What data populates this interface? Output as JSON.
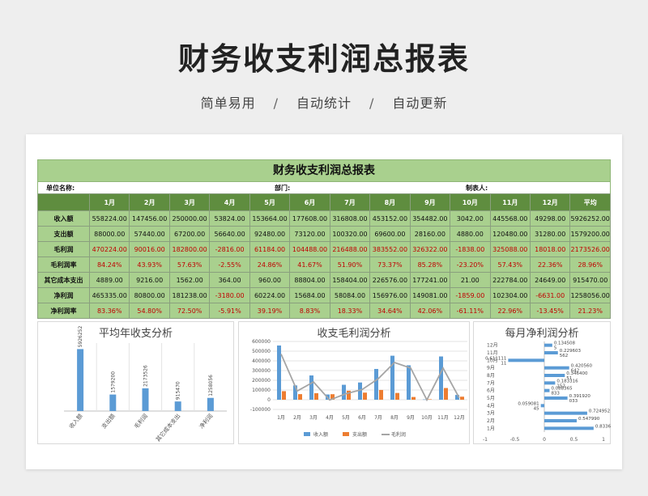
{
  "page": {
    "title": "财务收支利润总报表",
    "subtitle": [
      "简单易用",
      "/",
      "自动统计",
      "/",
      "自动更新"
    ]
  },
  "sheet": {
    "title": "财务收支利润总报表",
    "info": {
      "unit": "单位名称:",
      "dept": "部门:",
      "maker": "制表人:"
    },
    "months": [
      "1月",
      "2月",
      "3月",
      "4月",
      "5月",
      "6月",
      "7月",
      "8月",
      "9月",
      "10月",
      "11月",
      "12月",
      "平均"
    ],
    "rows": [
      {
        "label": "收入额",
        "type": "num",
        "values": [
          "558224.00",
          "147456.00",
          "250000.00",
          "53824.00",
          "153664.00",
          "177608.00",
          "316808.00",
          "453152.00",
          "354482.00",
          "3042.00",
          "445568.00",
          "49298.00",
          "5926252.00"
        ]
      },
      {
        "label": "支出额",
        "type": "num",
        "values": [
          "88000.00",
          "57440.00",
          "67200.00",
          "56640.00",
          "92480.00",
          "73120.00",
          "100320.00",
          "69600.00",
          "28160.00",
          "4880.00",
          "120480.00",
          "31280.00",
          "1579200.00"
        ]
      },
      {
        "label": "毛利润",
        "type": "red",
        "values": [
          "470224.00",
          "90016.00",
          "182800.00",
          "-2816.00",
          "61184.00",
          "104488.00",
          "216488.00",
          "383552.00",
          "326322.00",
          "-1838.00",
          "325088.00",
          "18018.00",
          "2173526.00"
        ]
      },
      {
        "label": "毛利润率",
        "type": "red",
        "values": [
          "84.24%",
          "43.93%",
          "57.63%",
          "-2.55%",
          "24.86%",
          "41.67%",
          "51.90%",
          "73.37%",
          "85.28%",
          "-23.20%",
          "57.43%",
          "22.36%",
          "28.96%"
        ]
      },
      {
        "label": "其它成本支出",
        "type": "num",
        "values": [
          "4889.00",
          "9216.00",
          "1562.00",
          "364.00",
          "960.00",
          "88804.00",
          "158404.00",
          "226576.00",
          "177241.00",
          "21.00",
          "222784.00",
          "24649.00",
          "915470.00"
        ]
      },
      {
        "label": "净利润",
        "type": "mixed",
        "values": [
          "465335.00",
          "80800.00",
          "181238.00",
          "-3180.00",
          "60224.00",
          "15684.00",
          "58084.00",
          "156976.00",
          "149081.00",
          "-1859.00",
          "102304.00",
          "-6631.00",
          "1258056.00"
        ]
      },
      {
        "label": "净利润率",
        "type": "red",
        "values": [
          "83.36%",
          "54.80%",
          "72.50%",
          "-5.91%",
          "39.19%",
          "8.83%",
          "18.33%",
          "34.64%",
          "42.06%",
          "-61.11%",
          "22.96%",
          "-13.45%",
          "21.23%"
        ]
      }
    ]
  },
  "chart_data": [
    {
      "type": "bar",
      "title": "平均年收支分析",
      "categories": [
        "收入额",
        "支出额",
        "毛利润",
        "其它成本支出",
        "净利润"
      ],
      "values": [
        5926252,
        1579200,
        2173526,
        915470,
        1258056
      ],
      "data_labels": [
        "5926252",
        "1579200",
        "2173526",
        "915470",
        "1258056"
      ],
      "colors": {
        "bar": "#5b9bd5"
      }
    },
    {
      "type": "bar",
      "title": "收支毛利润分析",
      "categories": [
        "1月",
        "2月",
        "3月",
        "4月",
        "5月",
        "6月",
        "7月",
        "8月",
        "9月",
        "10月",
        "11月",
        "12月"
      ],
      "ylim": [
        -100000,
        600000
      ],
      "yticks": [
        "600000",
        "500000",
        "400000",
        "300000",
        "200000",
        "100000",
        "0",
        "-100000"
      ],
      "series": [
        {
          "name": "收入额",
          "type": "bar",
          "color": "#5b9bd5",
          "values": [
            558224,
            147456,
            250000,
            53824,
            153664,
            177608,
            316808,
            453152,
            354482,
            3042,
            445568,
            49298
          ]
        },
        {
          "name": "支出额",
          "type": "bar",
          "color": "#ed7d31",
          "values": [
            88000,
            57440,
            67200,
            56640,
            92480,
            73120,
            100320,
            69600,
            28160,
            4880,
            120480,
            31280
          ]
        },
        {
          "name": "毛利润",
          "type": "line",
          "color": "#a5a5a5",
          "values": [
            470224,
            90016,
            182800,
            -2816,
            61184,
            104488,
            216488,
            383552,
            326322,
            -1838,
            325088,
            18018
          ]
        }
      ]
    },
    {
      "type": "bar",
      "orientation": "horizontal",
      "title": "每月净利润分析",
      "categories": [
        "1月",
        "2月",
        "3月",
        "4月",
        "5月",
        "6月",
        "7月",
        "8月",
        "9月",
        "10月",
        "11月",
        "12月"
      ],
      "values": [
        0.8336,
        0.548,
        0.725,
        -0.0591,
        0.3919,
        0.0883,
        0.1833,
        0.3464,
        0.4206,
        -0.6111,
        0.2296,
        0.1345
      ],
      "data_labels": [
        "0.8336",
        "0.547990",
        "0.724952",
        "0.059081\n45",
        "0.391920\n033",
        "0.088365\n833",
        "0.183316\n152",
        "0.346400\n51",
        "0.420560\n642",
        "0.611111\n11",
        "0.229603\n562",
        "0.134508\n5"
      ],
      "xticks": [
        "-1",
        "-0.5",
        "0",
        "0.5",
        "1"
      ],
      "colors": {
        "bar": "#5b9bd5"
      }
    }
  ]
}
